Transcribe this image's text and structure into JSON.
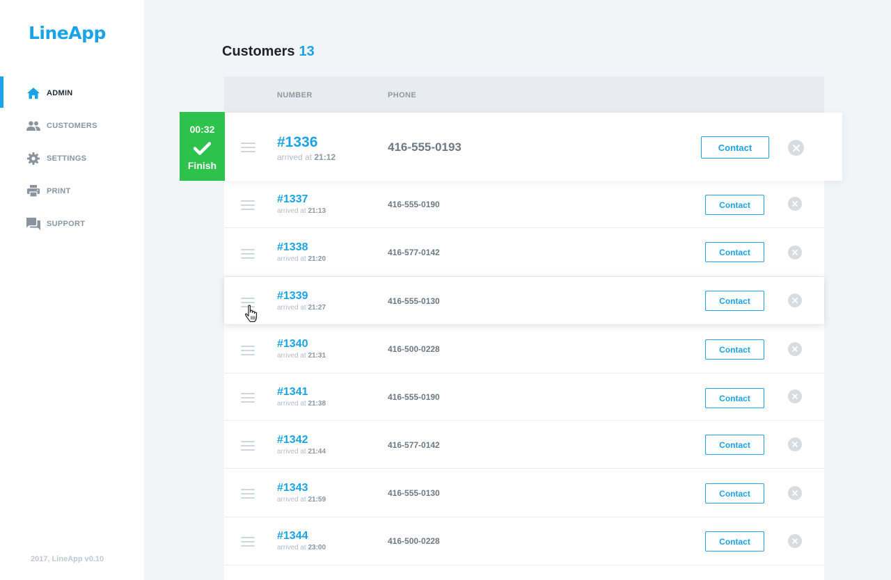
{
  "app": {
    "name": "LineApp",
    "footer": "2017, LineApp v0.10"
  },
  "colors": {
    "accent": "#1aa3e8",
    "finish": "#2dc24b",
    "sidebar_active": "#1aa3e8"
  },
  "sidebar": {
    "items": [
      {
        "label": "ADMIN",
        "icon": "home-icon",
        "active": true
      },
      {
        "label": "CUSTOMERS",
        "icon": "people-icon",
        "active": false
      },
      {
        "label": "SETTINGS",
        "icon": "gear-icon",
        "active": false
      },
      {
        "label": "PRINT",
        "icon": "printer-icon",
        "active": false
      },
      {
        "label": "SUPPORT",
        "icon": "chat-icon",
        "active": false
      }
    ]
  },
  "main": {
    "title": "Customers",
    "count": "13",
    "columns": {
      "number": "NUMBER",
      "phone": "PHONE"
    },
    "current": {
      "timer": "00:32",
      "finish_label": "Finish",
      "number": "#1336",
      "arrived_prefix": "arrived at",
      "arrived_time": "21:12",
      "phone": "416-555-0193",
      "contact_label": "Contact"
    },
    "rows": [
      {
        "number": "#1337",
        "arrived_prefix": "arrived at",
        "arrived_time": "21:13",
        "phone": "416-555-0190",
        "contact_label": "Contact"
      },
      {
        "number": "#1338",
        "arrived_prefix": "arrived at",
        "arrived_time": "21:20",
        "phone": "416-577-0142",
        "contact_label": "Contact"
      },
      {
        "number": "#1339",
        "arrived_prefix": "arrived at",
        "arrived_time": "21:27",
        "phone": "416-555-0130",
        "contact_label": "Contact"
      },
      {
        "number": "#1340",
        "arrived_prefix": "arrived at",
        "arrived_time": "21:31",
        "phone": "416-500-0228",
        "contact_label": "Contact"
      },
      {
        "number": "#1341",
        "arrived_prefix": "arrived at",
        "arrived_time": "21:38",
        "phone": "416-555-0190",
        "contact_label": "Contact"
      },
      {
        "number": "#1342",
        "arrived_prefix": "arrived at",
        "arrived_time": "21:44",
        "phone": "416-577-0142",
        "contact_label": "Contact"
      },
      {
        "number": "#1343",
        "arrived_prefix": "arrived at",
        "arrived_time": "21:59",
        "phone": "416-555-0130",
        "contact_label": "Contact"
      },
      {
        "number": "#1344",
        "arrived_prefix": "arrived at",
        "arrived_time": "23:00",
        "phone": "416-500-0228",
        "contact_label": "Contact"
      }
    ]
  }
}
